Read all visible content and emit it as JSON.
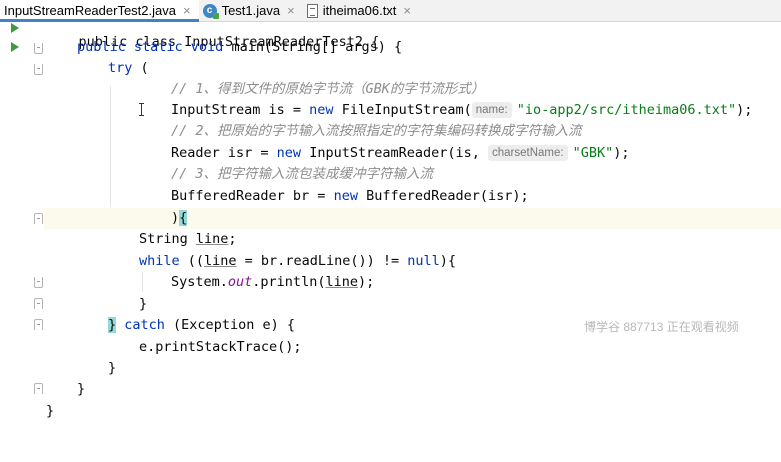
{
  "tabs": [
    {
      "label": "InputStreamReaderTest2.java",
      "close": "×",
      "active": true
    },
    {
      "label": "Test1.java",
      "close": "×",
      "icon_text": "c",
      "active": false
    },
    {
      "label": "itheima06.txt",
      "close": "×",
      "active": false
    }
  ],
  "code": {
    "l0": "public class InputStreamReaderTest2 {",
    "l1_kw": "public static void ",
    "l1_rest": "main(String[] args) {",
    "l2_kw": "try",
    "l2_rest": " (",
    "l3_comment": "// 1、得到文件的原始字节流（GBK的字节流形式）",
    "l4_pre": "InputStream is = ",
    "l4_new": "new",
    "l4_mid": " FileInputStream(",
    "l4_hint": "name:",
    "l4_str": "\"io-app2/src/itheima06.txt\"",
    "l4_end": ");",
    "l5_comment": "// 2、把原始的字节输入流按照指定的字符集编码转换成字符输入流",
    "l6_pre": "Reader isr = ",
    "l6_new": "new",
    "l6_mid": " InputStreamReader(is, ",
    "l6_hint": "charsetName:",
    "l6_str": "\"GBK\"",
    "l6_end": ");",
    "l7_comment": "// 3、把字符输入流包装成缓冲字符输入流",
    "l8_pre": "BufferedReader br = ",
    "l8_new": "new",
    "l8_end": " BufferedReader(isr);",
    "l9_paren": ")",
    "l9_brace": "{",
    "l10_pre": "String ",
    "l10_var": "line",
    "l10_end": ";",
    "l11_kw": "while",
    "l11_a": " ((",
    "l11_var": "line",
    "l11_b": " = br.readLine()) != ",
    "l11_null": "null",
    "l11_c": "){",
    "l12_a": "System.",
    "l12_out": "out",
    "l12_b": ".println(",
    "l12_var": "line",
    "l12_c": ");",
    "l13": "}",
    "l14_brace": "}",
    "l14_kw": " catch",
    "l14_rest": " (Exception e) {",
    "l15": "e.printStackTrace();",
    "l16": "}",
    "l17": "}",
    "l18": "}"
  },
  "watermark": "博学谷 887713 正在观看视频",
  "colors": {
    "keyword": "#0033b3",
    "string": "#067d17",
    "comment": "#8c8c8c",
    "field": "#871094",
    "tab_accent": "#4083c9"
  }
}
